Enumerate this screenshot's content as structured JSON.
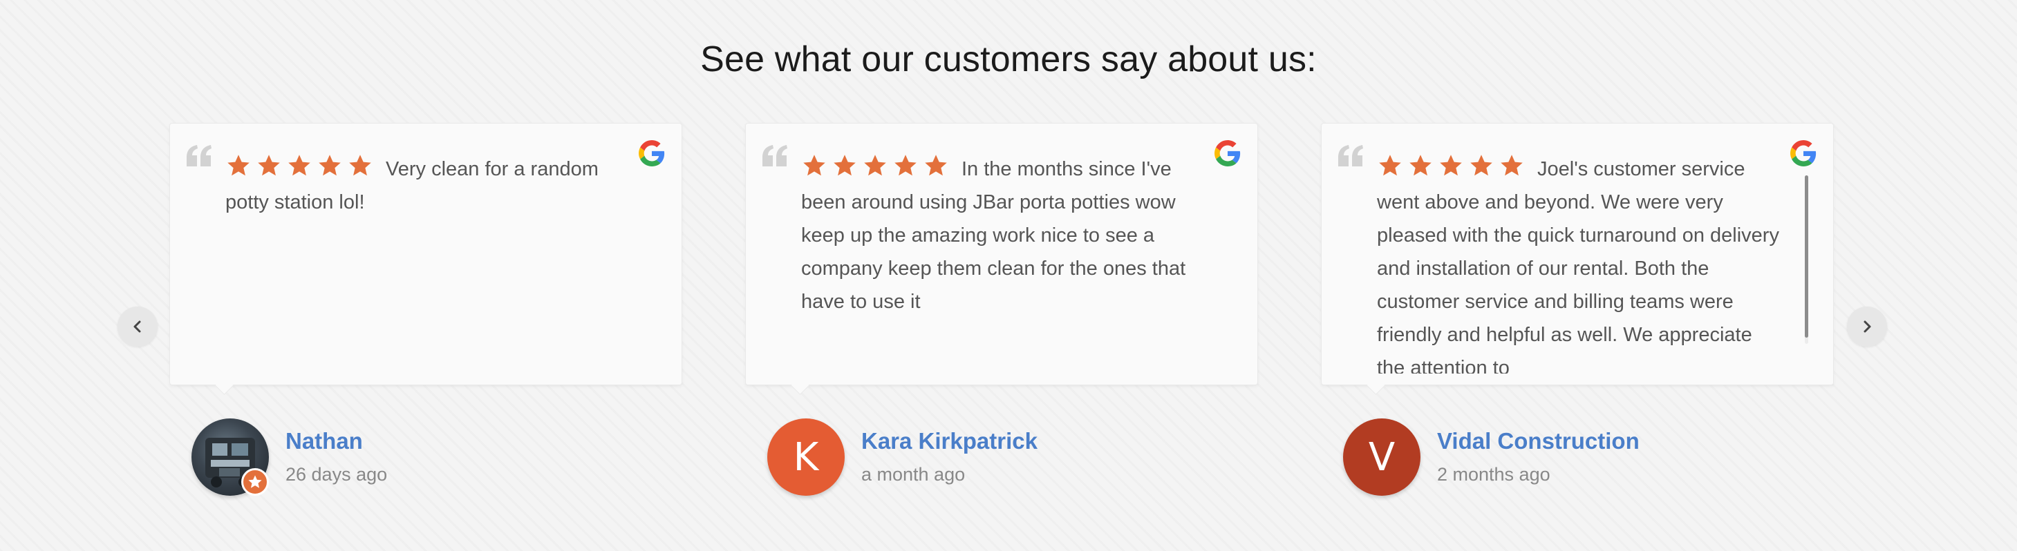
{
  "section": {
    "title": "See what our customers say about us:"
  },
  "nav": {
    "prev_icon": "chevron-left-icon",
    "next_icon": "chevron-right-icon"
  },
  "colors": {
    "star": "#e3703b",
    "author_link": "#4a7ec9",
    "avatar_kara": "#e45c33",
    "avatar_vidal": "#b23c22"
  },
  "reviews": [
    {
      "rating": 5,
      "text": "Very clean for a random potty station lol!",
      "source_icon": "google-icon",
      "author": {
        "name": "Nathan",
        "time": "26 days ago",
        "avatar_type": "photo"
      }
    },
    {
      "rating": 5,
      "text": "In the months since I've been around using JBar porta potties wow keep up the amazing work nice to see a company keep them clean for the ones that have to use it",
      "source_icon": "google-icon",
      "author": {
        "name": "Kara Kirkpatrick",
        "time": "a month ago",
        "avatar_letter": "K"
      }
    },
    {
      "rating": 5,
      "text": "Joel's customer service went above and beyond. We were very pleased with the quick turnaround on delivery and installation of our rental. Both the customer service and billing teams were friendly and helpful as well. We appreciate the attention to",
      "source_icon": "google-icon",
      "author": {
        "name": "Vidal Construction",
        "time": "2 months ago",
        "avatar_letter": "V"
      }
    }
  ]
}
